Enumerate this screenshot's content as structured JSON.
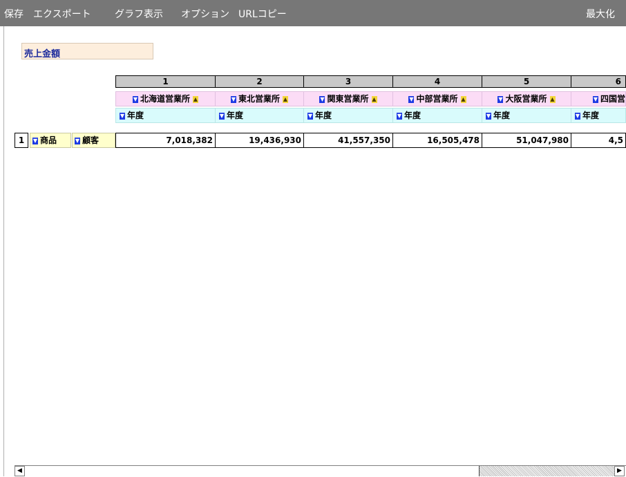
{
  "menu": {
    "save": "保存",
    "export": "エクスポート",
    "graph": "グラフ表示",
    "options": "オプション",
    "url_copy": "URLコピー",
    "maximize": "最大化"
  },
  "measure_label": "売上金額",
  "columns": [
    {
      "num": "1",
      "office": "北海道営業所",
      "year": "年度",
      "value": "7,018,382"
    },
    {
      "num": "2",
      "office": "東北営業所",
      "year": "年度",
      "value": "19,436,930"
    },
    {
      "num": "3",
      "office": "関東営業所",
      "year": "年度",
      "value": "41,557,350"
    },
    {
      "num": "4",
      "office": "中部営業所",
      "year": "年度",
      "value": "16,505,478"
    },
    {
      "num": "5",
      "office": "大阪営業所",
      "year": "年度",
      "value": "51,047,980"
    },
    {
      "num": "6",
      "office": "四国営",
      "year": "年度",
      "value": "4,5"
    }
  ],
  "row": {
    "num": "1",
    "dim1": "商品",
    "dim2": "顧客"
  },
  "colors": {
    "menubar": "#777777",
    "office_header": "#fbdcf6",
    "year_header": "#d9fbfc",
    "row_header": "#ffffcc",
    "measure_box": "#fdeedd",
    "measure_text": "#1b2a9c"
  }
}
